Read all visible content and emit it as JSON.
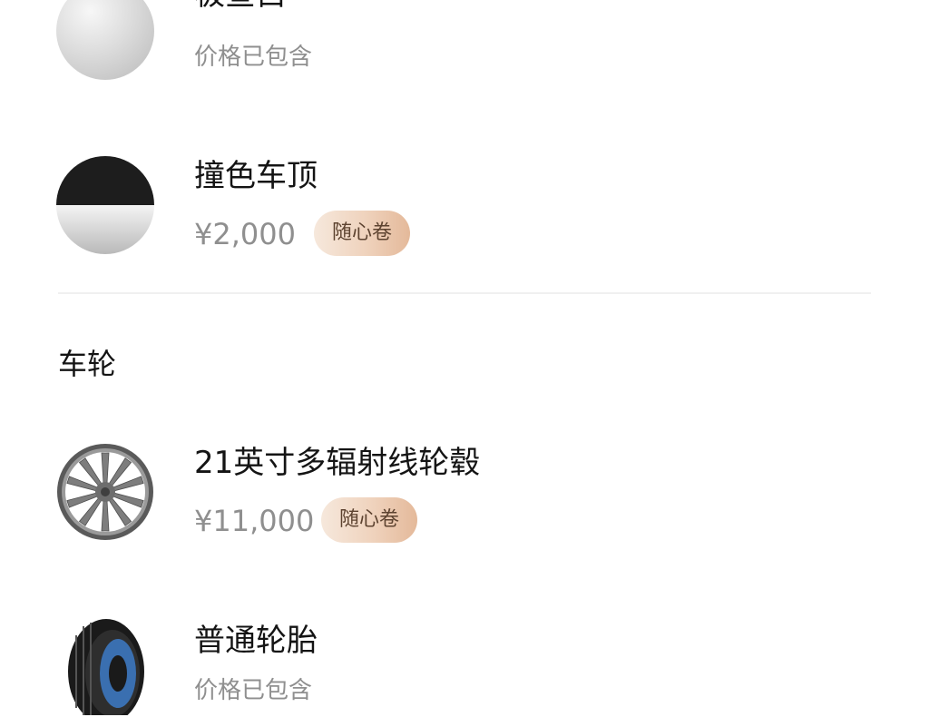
{
  "colors": {
    "divider": "#f0f0f0",
    "price_gray": "#8f8f8f",
    "coupon_text": "#5d4330"
  },
  "options": [
    {
      "name": "极昼白",
      "price_note": "价格已包含",
      "icon": "silver-paint-swatch-icon"
    },
    {
      "name": "撞色车顶",
      "price": "¥2,000",
      "coupon": "随心卷",
      "icon": "two-tone-roof-swatch-icon"
    }
  ],
  "wheels_section": {
    "title": "车轮",
    "items": [
      {
        "name": "21英寸多辐射线轮毂",
        "price": "¥11,000",
        "coupon": "随心卷",
        "icon": "multi-spoke-wheel-icon"
      },
      {
        "name": "普通轮胎",
        "price_note": "价格已包含",
        "icon": "tire-icon"
      }
    ]
  }
}
